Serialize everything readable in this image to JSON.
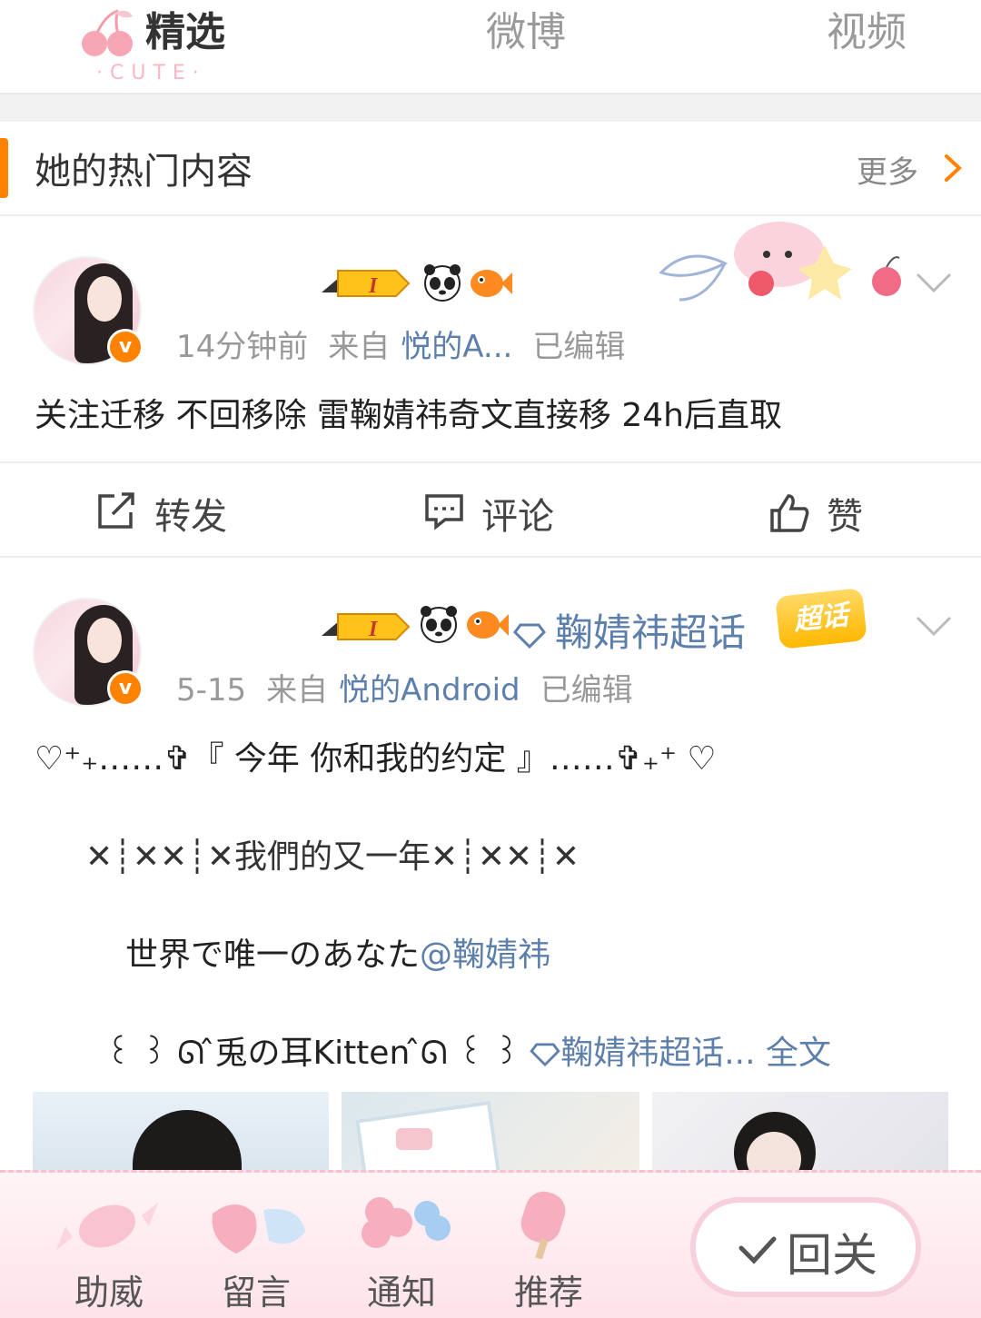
{
  "tabs": {
    "featured": "精选",
    "featured_logo_text": "·CUTE·",
    "weibo": "微博",
    "video": "视频"
  },
  "section": {
    "title": "她的热门内容",
    "more": "更多"
  },
  "posts": [
    {
      "time": "14分钟前",
      "source_prefix": "来自",
      "source": "悦的A...",
      "edited": "已编辑",
      "level_badge": "I",
      "text": "关注迁移 不回移除 雷鞠婧祎奇文直接移 24h后直取",
      "actions": {
        "repost": "转发",
        "comment": "评论",
        "like": "赞"
      }
    },
    {
      "time": "5-15",
      "source_prefix": "来自",
      "source": "悦的Android",
      "edited": "已编辑",
      "level_badge": "I",
      "supertopic": "鞠婧祎超话",
      "supertopic_badge": "超话",
      "lines": {
        "line1": "♡⁺₊……✞『 今年 你和我的约定 』……✞₊⁺ ♡",
        "line2": "✕┊✕✕┊✕我們的又一年✕┊✕✕┊✕",
        "line3_prefix": "世界で唯一のあなた",
        "line3_mention": "@鞠婧祎",
        "line4_prefix": "꒰ ꒱ ᘏ ̂兎の耳Kitten ̂ᘏ ꒰ ꒱",
        "line4_topic": "鞠婧祎超话...",
        "line4_more": "全文"
      }
    }
  ],
  "bottom_nav": {
    "assist": "助威",
    "message": "留言",
    "notify": "通知",
    "recommend": "推荐",
    "back": "回关"
  },
  "colors": {
    "accent_orange": "#ff8200",
    "link_blue": "#5d7fab",
    "pink_theme": "#f7c1cf"
  }
}
